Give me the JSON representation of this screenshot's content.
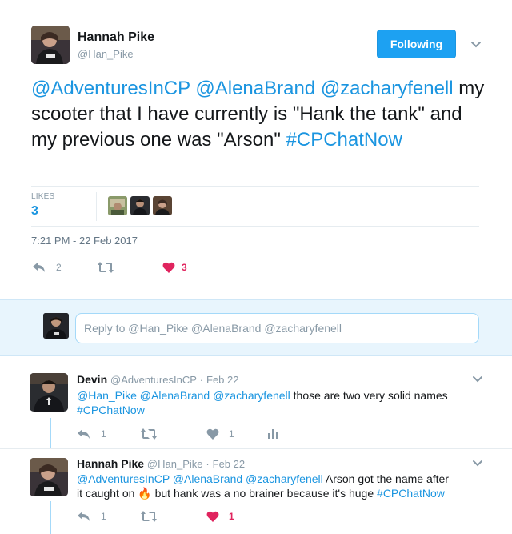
{
  "tweet": {
    "author_name": "Hannah Pike",
    "author_handle": "@Han_Pike",
    "follow_label": "Following",
    "text_mentions": "@AdventuresInCP @AlenaBrand @zacharyfenell",
    "text_body": " my scooter that I have currently is \"Hank the tank\" and my previous one was \"Arson\" ",
    "text_hashtag": "#CPChatNow",
    "likes_label": "LIKES",
    "likes_count": "3",
    "timestamp": "7:21 PM - 22 Feb 2017",
    "reply_count": "2",
    "like_count": "3"
  },
  "reply_box": {
    "placeholder": "Reply to @Han_Pike @AlenaBrand @zacharyfenell"
  },
  "replies": [
    {
      "name": "Devin",
      "handle": "@AdventuresInCP",
      "dot": "·",
      "date": "Feb 22",
      "mentions": "@Han_Pike @AlenaBrand @zacharyfenell",
      "text": " those are two very solid names",
      "hashtag": "#CPChatNow",
      "reply_count": "1",
      "like_count": "1"
    },
    {
      "name": "Hannah Pike",
      "handle": "@Han_Pike",
      "dot": "·",
      "date": "Feb 22",
      "mentions": "@AdventuresInCP @AlenaBrand @zacharyfenell",
      "text_a": " Arson got the name after it caught on ",
      "emoji": "🔥",
      "text_b": " but hank was a no brainer because it's huge ",
      "hashtag": "#CPChatNow",
      "reply_count": "1",
      "like_count": "1"
    }
  ],
  "colors": {
    "accent": "#1da1f2",
    "link": "#1b95e0",
    "heart": "#e0245e",
    "muted": "#8899a6"
  }
}
